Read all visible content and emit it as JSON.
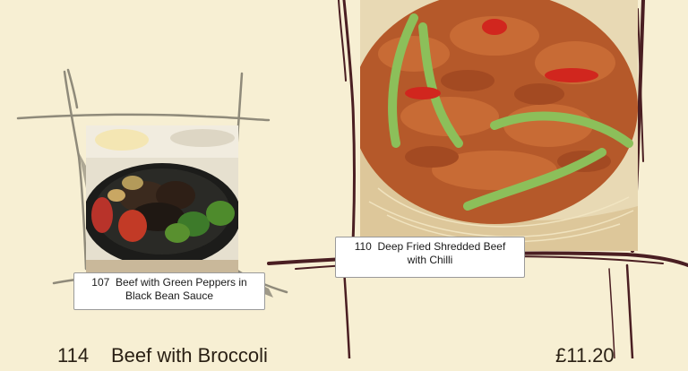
{
  "dishes": [
    {
      "number": "107",
      "name_line1": "Beef with Green Peppers in",
      "name_line2": "Black Bean Sauce"
    },
    {
      "number": "110",
      "name_line1": "Deep Fried Shredded Beef",
      "name_line2": "with Chilli"
    }
  ],
  "menu_row": {
    "number": "114",
    "name": "Beef with Broccoli",
    "price": "£11.20"
  },
  "colors": {
    "background": "#f7efd3",
    "sketch_frame": "#4a1e22",
    "sketch_grey": "#8c8878"
  }
}
